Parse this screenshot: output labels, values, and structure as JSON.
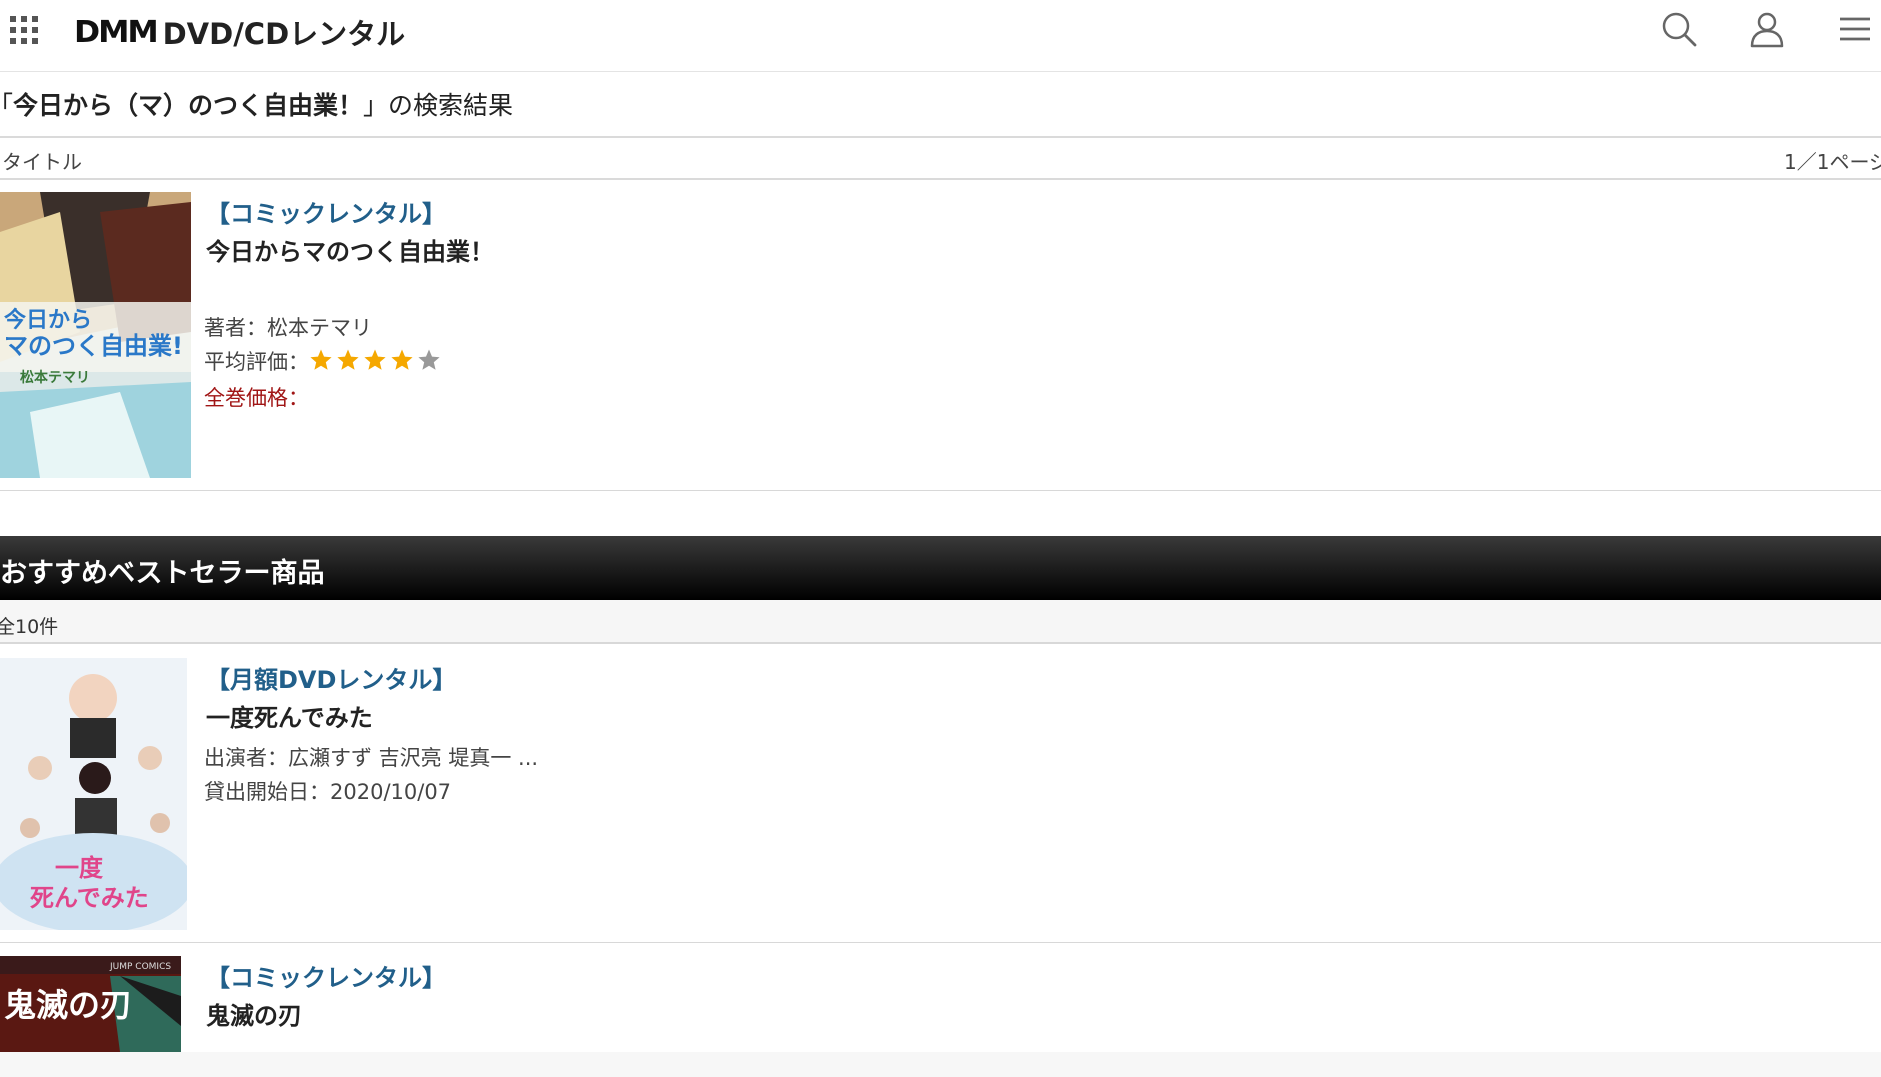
{
  "header": {
    "logo": "DMM",
    "site_name": "DVD/CDレンタル"
  },
  "search": {
    "open_quote": "「",
    "query": "今日から（マ）のつく自由業！",
    "close_quote": "」",
    "suffix": "の検索結果",
    "tab_label": "タイトル",
    "page_info": "1／1ページ"
  },
  "result": {
    "category": "【コミックレンタル】",
    "title": "今日からマのつく自由業！",
    "author": "著者：松本テマリ",
    "rating_label": "平均評価：",
    "rating": 4,
    "rating_max": 5,
    "price_label": "全巻価格："
  },
  "bestseller": {
    "heading": "おすすめベストセラー商品",
    "count": "全10件",
    "items": [
      {
        "category": "【月額DVDレンタル】",
        "title": "一度死んでみた",
        "cast": "出演者：広瀬すず 吉沢亮 堤真一 ...",
        "release": "貸出開始日：2020/10/07"
      },
      {
        "category": "【コミックレンタル】",
        "title": "鬼滅の刃"
      }
    ]
  },
  "colors": {
    "category_blue": "#215f8a",
    "price_red": "#a01515",
    "star_gold": "#f5a800",
    "star_gray": "#999999"
  }
}
